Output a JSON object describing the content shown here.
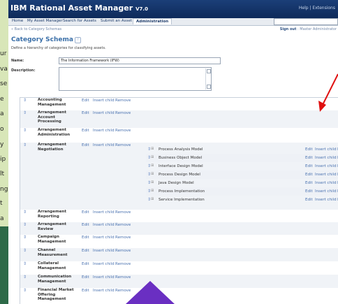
{
  "app": {
    "title": "IBM Rational Asset Manager",
    "version": "V7.0",
    "help_text": "Help | Extensions"
  },
  "nav": {
    "tabs": [
      "Home",
      "My Asset Manager",
      "Search for Assets",
      "Submit an Asset",
      "Administration"
    ],
    "active": "Administration"
  },
  "subnav": {
    "back_link": "« Back to Category Schemas",
    "sign_out": "Sign out",
    "user": "Master Administrator"
  },
  "page": {
    "title": "Category Schema",
    "description": "Define a hierarchy of categories for classifying assets.",
    "name_label": "Name:",
    "name_value": "The Information Framework (IFW)",
    "description_label": "Description:"
  },
  "actions": {
    "edit": "Edit",
    "insert_child": "Insert child",
    "remove": "Remove"
  },
  "categories": [
    "Accounting Management",
    "Arrangement Account Processing",
    "Arrangement Administration",
    "Arrangement Negotiation",
    "Arrangement Reporting",
    "Arrangement Review",
    "Campaign Management",
    "Channel Measurement",
    "Collateral Management",
    "Communication Management",
    "Financial Market Offering Management"
  ],
  "children": [
    "Process Analysis Model",
    "Business Object Model",
    "Interface Design Model",
    "Process Design Model",
    "Java Design Model",
    "Process Implementation",
    "Service Implementation"
  ],
  "background_fragments": [
    "ur",
    "va",
    "se",
    "e",
    "a",
    "o",
    "y",
    "ip",
    "lt",
    "ng",
    "t",
    "a"
  ],
  "colors": {
    "title_bar": "#1b3f78",
    "link": "#4a72b0",
    "heading": "#3a6fa8",
    "arrow": "#e01010",
    "slide_bg": "#2e6a48"
  }
}
